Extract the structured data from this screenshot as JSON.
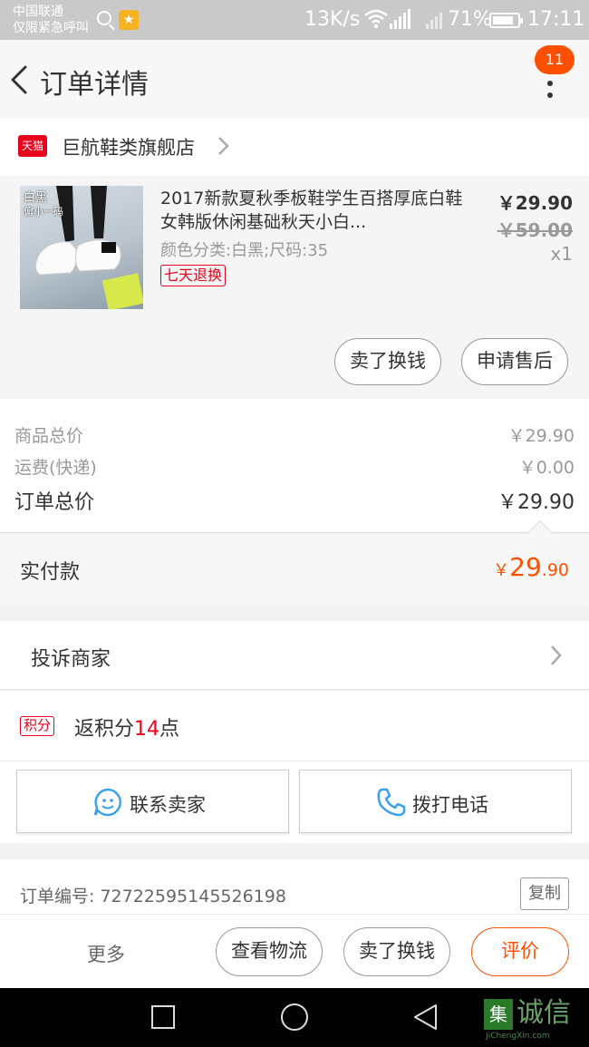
{
  "status_bar": {
    "carrier_line1": "中国联通",
    "carrier_line2": "仅限紧急呼叫",
    "speed": "13K/s",
    "battery": "71%",
    "time": "17:11"
  },
  "header": {
    "title": "订单详情",
    "badge_count": "11"
  },
  "store": {
    "logo_text": "天猫",
    "name": "巨航鞋类旗舰店"
  },
  "product": {
    "image_tag": "白黑",
    "image_tag2": "偏小一码",
    "title": "2017新款夏秋季板鞋学生百搭厚底白鞋女韩版休闲基础秋天小白...",
    "sku": "颜色分类:白黑;尺码:35",
    "return_tag": "七天退换",
    "price_now": "￥29.90",
    "price_old": "￥59.00",
    "qty": "x1",
    "btn_sell": "卖了换钱",
    "btn_aftersale": "申请售后"
  },
  "summary": {
    "goods_label": "商品总价",
    "goods_value": "￥29.90",
    "shipping_label": "运费(快递)",
    "shipping_value": "￥0.00",
    "total_label": "订单总价",
    "total_value": "￥29.90",
    "paid_label": "实付款",
    "paid_currency": "￥",
    "paid_int": "29",
    "paid_dec": ".90"
  },
  "complaint": {
    "label": "投诉商家"
  },
  "points": {
    "tag": "积分",
    "prefix": "返积分",
    "num": "14",
    "suffix": "点"
  },
  "contact": {
    "contact_label": "联系卖家",
    "call_label": "拨打电话"
  },
  "order": {
    "number_text": "订单编号: 72722595145526198",
    "copy_label": "复制"
  },
  "bottom_bar": {
    "more": "更多",
    "logistics": "查看物流",
    "sell": "卖了换钱",
    "review": "评价"
  },
  "watermark": {
    "box": "集",
    "text": "诚信",
    "sub": "JiChengXin.com"
  },
  "colors": {
    "accent": "#ff5000",
    "tmall_red": "#e8001c",
    "icon_blue": "#3aa0e8"
  }
}
